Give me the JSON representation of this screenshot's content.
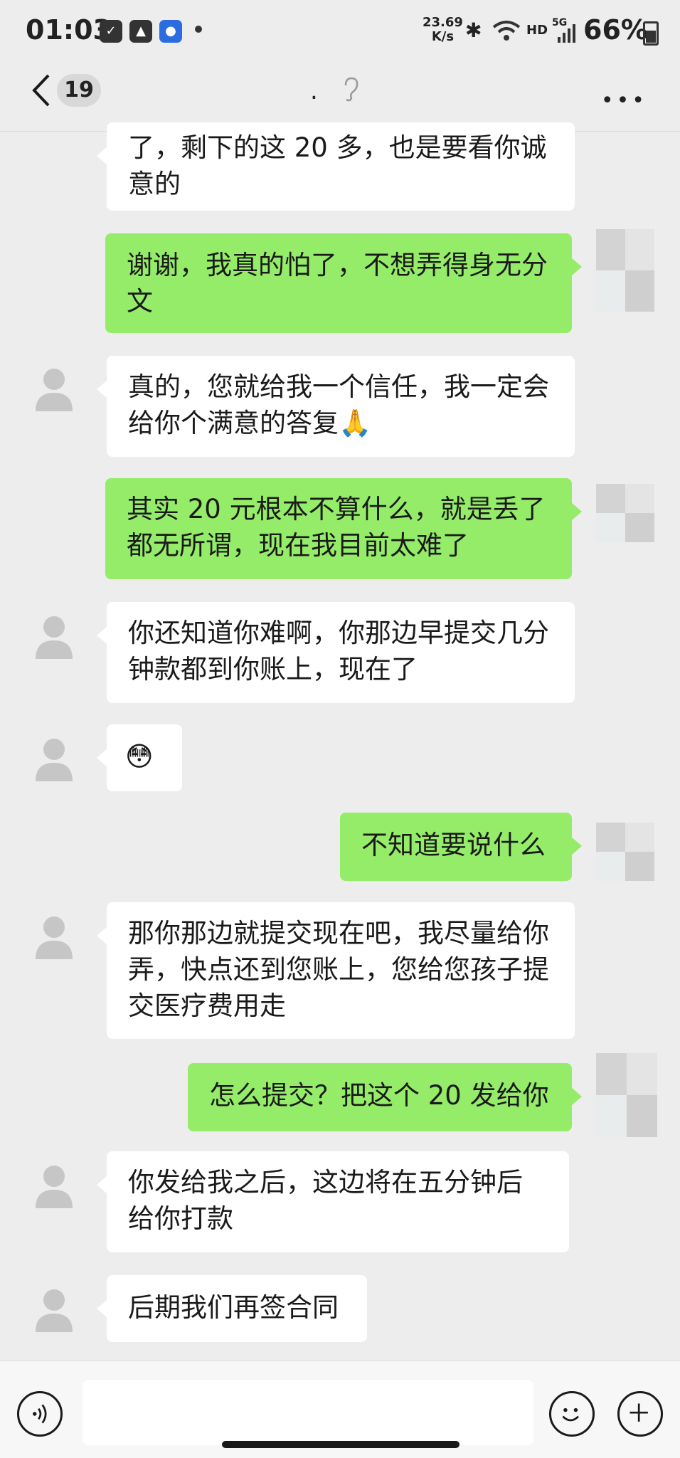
{
  "status_bar": {
    "time": "01:03",
    "net_speed_value": "23.69",
    "net_speed_unit": "K/s",
    "hd": "HD",
    "network": "5G",
    "battery": "66%"
  },
  "header": {
    "back_badge": "19",
    "title": "."
  },
  "messages": [
    {
      "side": "received",
      "text": "了，剩下的这 20 多，也是要看你诚意的"
    },
    {
      "side": "sent",
      "text": "谢谢，我真的怕了，不想弄得身无分文"
    },
    {
      "side": "received",
      "text": "真的，您就给我一个信任，我一定会给你个满意的答复🙏"
    },
    {
      "side": "sent",
      "text": "其实 20 元根本不算什么，就是丢了都无所谓，现在我目前太难了"
    },
    {
      "side": "received",
      "text": "你还知道你难啊，你那边早提交几分钟款都到你账上，现在了"
    },
    {
      "side": "received",
      "text": "😳"
    },
    {
      "side": "sent",
      "text": "不知道要说什么"
    },
    {
      "side": "received",
      "text": "那你那边就提交现在吧，我尽量给你弄，快点还到您账上，您给您孩子提交医疗费用走"
    },
    {
      "side": "sent",
      "text": "怎么提交？把这个 20 发给你"
    },
    {
      "side": "received",
      "text": "你发给我之后，这边将在五分钟后给你打款"
    },
    {
      "side": "received",
      "text": "后期我们再签合同"
    }
  ],
  "icons": [
    "chevron-left-icon",
    "ear-icon",
    "more-icon",
    "voice-icon",
    "emoji-icon",
    "plus-icon"
  ],
  "colors": {
    "sent_bubble": "#95ec69",
    "received_bubble": "#ffffff",
    "background": "#ededed"
  }
}
